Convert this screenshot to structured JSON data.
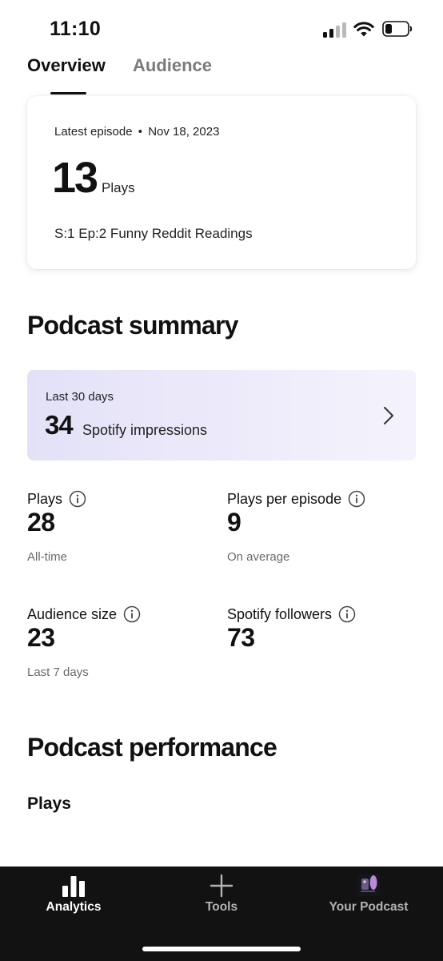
{
  "status_bar": {
    "time": "11:10",
    "icons": [
      "cellular-signal-icon",
      "wifi-icon",
      "battery-icon"
    ]
  },
  "tabs": [
    {
      "label": "Overview",
      "active": true
    },
    {
      "label": "Audience",
      "active": false
    }
  ],
  "latest_episode": {
    "label": "Latest episode",
    "separator": "•",
    "date": "Nov 18, 2023",
    "plays": "13",
    "plays_label": "Plays",
    "title": "S:1 Ep:2 Funny Reddit Readings"
  },
  "podcast_summary": {
    "title": "Podcast summary",
    "impressions": {
      "period": "Last 30 days",
      "value": "34",
      "label": "Spotify impressions",
      "icon": "chevron-right-icon"
    },
    "stats": [
      {
        "label": "Plays",
        "value": "28",
        "sub": "All-time",
        "icon": "info-icon"
      },
      {
        "label": "Plays per episode",
        "value": "9",
        "sub": "On average",
        "icon": "info-icon"
      },
      {
        "label": "Audience size",
        "value": "23",
        "sub": "Last 7 days",
        "icon": "info-icon"
      },
      {
        "label": "Spotify followers",
        "value": "73",
        "sub": "",
        "icon": "info-icon"
      }
    ]
  },
  "podcast_performance": {
    "title": "Podcast performance",
    "subtitle": "Plays"
  },
  "bottom_nav": [
    {
      "label": "Analytics",
      "icon": "bar-chart-icon",
      "active": true
    },
    {
      "label": "Tools",
      "icon": "plus-icon",
      "active": false
    },
    {
      "label": "Your Podcast",
      "icon": "podcast-cover-icon",
      "active": false
    }
  ],
  "colors": {
    "nav_background": "#121212",
    "impressions_card": "#e8e6f8",
    "inactive_tab": "#7b7b7b",
    "active_nav": "#ffffff",
    "inactive_nav": "#b3b3b3"
  }
}
